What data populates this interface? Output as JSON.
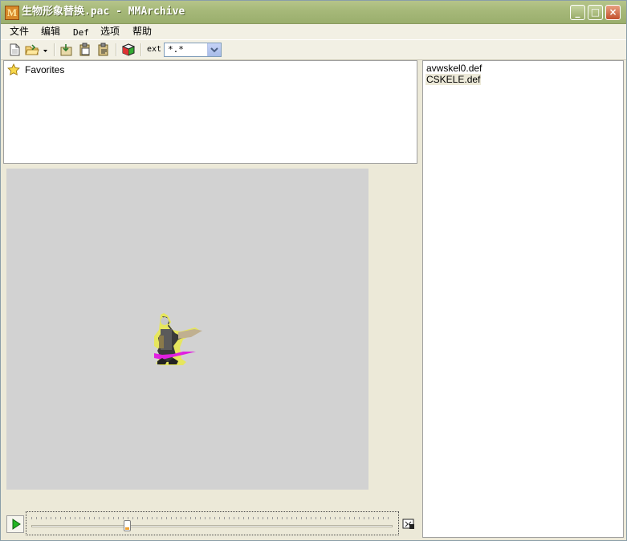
{
  "window": {
    "title": "生物形象替换.pac - MMArchive",
    "app_icon_letter": "M"
  },
  "menu": [
    {
      "label": "文件"
    },
    {
      "label": "编辑"
    },
    {
      "label": "Def"
    },
    {
      "label": "选项"
    },
    {
      "label": "帮助"
    }
  ],
  "toolbar": {
    "icons": [
      "new-file-icon",
      "open-folder-icon",
      "dropdown-arrow-icon",
      "extract-icon",
      "paste-icon",
      "replace-icon",
      "rubiks-cube-icon"
    ],
    "ext_label": "ext",
    "ext_value": "*.*"
  },
  "tree": {
    "favorites_label": "Favorites"
  },
  "files": [
    {
      "name": "avwskel0.def",
      "selected": false
    },
    {
      "name": "CSKELE.def",
      "selected": true
    }
  ],
  "preview": {
    "background": "#d2d2d2",
    "sprite": "skeleton-warrior"
  },
  "player": {
    "progress": 0.26
  },
  "colors": {
    "window_bg": "#ece9d8",
    "titlebar": "#a7b97a",
    "panel_border": "#a0a0a0"
  }
}
